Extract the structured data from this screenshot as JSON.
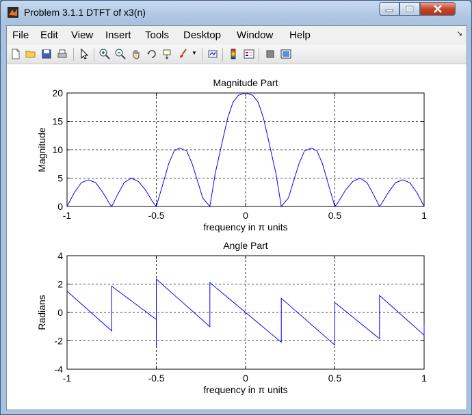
{
  "window": {
    "title": "Problem 3.1.1 DTFT of x3(n)"
  },
  "menu": [
    "File",
    "Edit",
    "View",
    "Insert",
    "Tools",
    "Desktop",
    "Window",
    "Help"
  ],
  "toolbar_icons": [
    "new-file-icon",
    "open-folder-icon",
    "save-icon",
    "print-icon",
    "pointer-icon",
    "zoom-in-icon",
    "zoom-out-icon",
    "pan-icon",
    "rotate-3d-icon",
    "data-cursor-icon",
    "brush-icon",
    "link-plot-icon",
    "colorbar-icon",
    "legend-icon",
    "hide-plot-tools-icon",
    "show-plot-tools-icon"
  ],
  "colors": {
    "line": "#0000ff",
    "grid": "#000000"
  },
  "chart_data": [
    {
      "type": "line",
      "title": "Magnitude Part",
      "xlabel": "frequency in π units",
      "ylabel": "Magnitude",
      "xlim": [
        -1,
        1
      ],
      "ylim": [
        0,
        20
      ],
      "xticks": [
        -1,
        -0.5,
        0,
        0.5,
        1
      ],
      "yticks": [
        0,
        5,
        10,
        15,
        20
      ],
      "xtick_labels": [
        "-1",
        "-0.5",
        "0",
        "0.5",
        "1"
      ],
      "ytick_labels": [
        "0",
        "5",
        "10",
        "15",
        "20"
      ],
      "grid": true,
      "series": [
        {
          "x": [
            -1,
            -0.96,
            -0.92,
            -0.88,
            -0.84,
            -0.8,
            -0.76,
            -0.75,
            -0.72,
            -0.68,
            -0.64,
            -0.6,
            -0.56,
            -0.52,
            -0.5,
            -0.47,
            -0.43,
            -0.4,
            -0.37,
            -0.33,
            -0.3,
            -0.27,
            -0.24,
            -0.2,
            -0.17,
            -0.13,
            -0.1,
            -0.07,
            -0.04,
            0,
            0.04,
            0.07,
            0.1,
            0.13,
            0.17,
            0.2,
            0.24,
            0.27,
            0.3,
            0.33,
            0.37,
            0.4,
            0.43,
            0.47,
            0.5,
            0.52,
            0.56,
            0.6,
            0.64,
            0.68,
            0.72,
            0.75,
            0.76,
            0.8,
            0.84,
            0.88,
            0.92,
            0.96,
            1
          ],
          "y": [
            0,
            2.4,
            4.2,
            4.7,
            4.2,
            2.5,
            0.4,
            0,
            1.9,
            4.2,
            5,
            4.4,
            2.9,
            0.8,
            0,
            3.2,
            7.6,
            9.8,
            10.3,
            9.8,
            7.6,
            4.6,
            1.5,
            0,
            5.8,
            11.5,
            15.6,
            18.4,
            19.6,
            20,
            19.6,
            18.4,
            15.6,
            11.5,
            5.8,
            0,
            1.5,
            4.6,
            7.6,
            9.8,
            10.3,
            9.8,
            7.6,
            3.2,
            0,
            0.8,
            2.9,
            4.4,
            5,
            4.2,
            1.9,
            0,
            0.4,
            2.5,
            4.2,
            4.7,
            4.2,
            2.4,
            0
          ]
        }
      ]
    },
    {
      "type": "line",
      "title": "Angle Part",
      "xlabel": "frequency in π units",
      "ylabel": "Radians",
      "xlim": [
        -1,
        1
      ],
      "ylim": [
        -4,
        4
      ],
      "xticks": [
        -1,
        -0.5,
        0,
        0.5,
        1
      ],
      "yticks": [
        -4,
        -2,
        0,
        2,
        4
      ],
      "xtick_labels": [
        "-1",
        "-0.5",
        "0",
        "0.5",
        "1"
      ],
      "ytick_labels": [
        "-4",
        "-2",
        "0",
        "2",
        "4"
      ],
      "grid": true,
      "series": [
        {
          "x": [
            -1,
            -0.75,
            -0.75,
            -0.5,
            -0.5,
            -0.5,
            -0.2,
            -0.2,
            0.2,
            0.2,
            0.5,
            0.5,
            0.5,
            0.75,
            0.75,
            1,
            1
          ],
          "y": [
            1.5,
            -1.3,
            1.85,
            -0.5,
            -2.5,
            2.35,
            -1,
            2.1,
            -2.1,
            1,
            -2.3,
            -1.6,
            0.7,
            -1.85,
            1.2,
            -1.6,
            -0.8
          ]
        }
      ]
    }
  ]
}
